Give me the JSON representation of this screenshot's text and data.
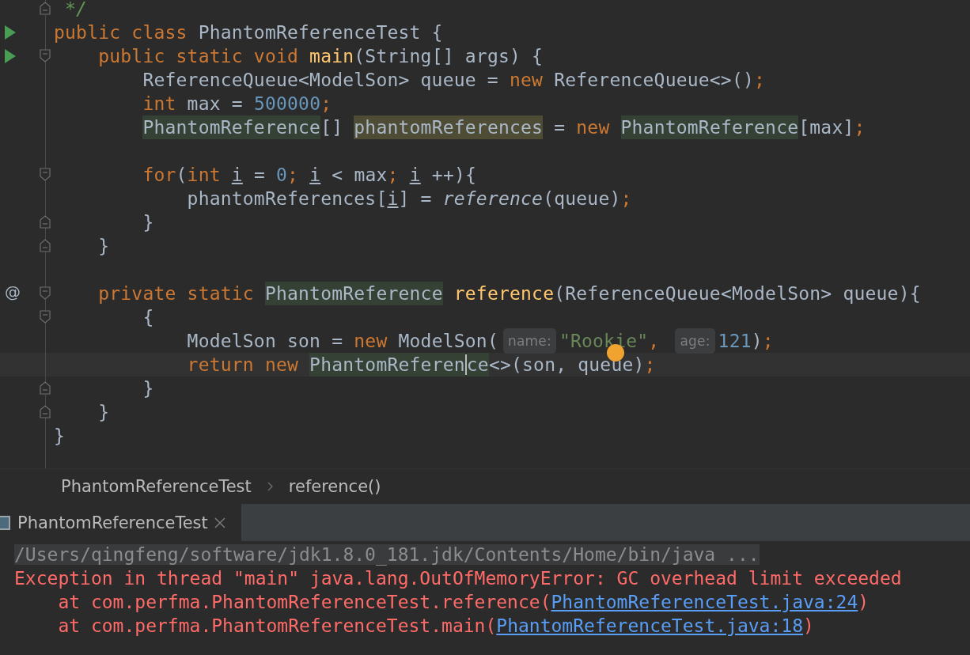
{
  "editor": {
    "lines": [
      {
        "fold_end": true,
        "tokens": [
          {
            "text": " */",
            "kind": "comment"
          }
        ]
      },
      {
        "runnable": true,
        "tokens": [
          {
            "text": "public class ",
            "kind": "keyword"
          },
          {
            "text": "PhantomReferenceTest {",
            "kind": "plain"
          }
        ]
      },
      {
        "runnable": true,
        "fold_start": true,
        "tokens": [
          {
            "text": "    public static void ",
            "kind": "keyword"
          },
          {
            "text": "main",
            "kind": "method"
          },
          {
            "text": "(String[] args) {",
            "kind": "plain"
          }
        ]
      },
      {
        "tokens": [
          {
            "text": "        ReferenceQueue<ModelSon> queue = ",
            "kind": "plain"
          },
          {
            "text": "new ",
            "kind": "keyword"
          },
          {
            "text": "ReferenceQueue<>()",
            "kind": "plain"
          },
          {
            "text": ";",
            "kind": "keyword"
          }
        ]
      },
      {
        "tokens": [
          {
            "text": "        int ",
            "kind": "keyword"
          },
          {
            "text": "max = ",
            "kind": "plain"
          },
          {
            "text": "500000",
            "kind": "number"
          },
          {
            "text": ";",
            "kind": "keyword"
          }
        ]
      },
      {
        "tokens": [
          {
            "text": "        PhantomReference",
            "kind": "class-highlight"
          },
          {
            "text": "[] ",
            "kind": "plain"
          },
          {
            "text": "phantomReferences",
            "kind": "var-highlight"
          },
          {
            "text": " = ",
            "kind": "plain"
          },
          {
            "text": "new ",
            "kind": "keyword"
          },
          {
            "text": "PhantomReference",
            "kind": "class-highlight"
          },
          {
            "text": "[max]",
            "kind": "plain"
          },
          {
            "text": ";",
            "kind": "keyword"
          }
        ]
      },
      {
        "kind": "blank"
      },
      {
        "fold_start": true,
        "tokens": [
          {
            "text": "        for",
            "kind": "keyword"
          },
          {
            "text": "(",
            "kind": "plain"
          },
          {
            "text": "int ",
            "kind": "keyword"
          },
          {
            "text": "i",
            "kind": "local"
          },
          {
            "text": " = ",
            "kind": "plain"
          },
          {
            "text": "0",
            "kind": "number"
          },
          {
            "text": "; ",
            "kind": "keyword"
          },
          {
            "text": "i",
            "kind": "local"
          },
          {
            "text": " < max",
            "kind": "plain"
          },
          {
            "text": "; ",
            "kind": "keyword"
          },
          {
            "text": "i",
            "kind": "local"
          },
          {
            "text": " ++){",
            "kind": "plain"
          }
        ]
      },
      {
        "tokens": [
          {
            "text": "            phantomReferences[",
            "kind": "plain"
          },
          {
            "text": "i",
            "kind": "local"
          },
          {
            "text": "] = ",
            "kind": "plain"
          },
          {
            "text": "reference",
            "kind": "static-call"
          },
          {
            "text": "(queue)",
            "kind": "plain"
          },
          {
            "text": ";",
            "kind": "keyword"
          }
        ]
      },
      {
        "fold_end": true,
        "tokens": [
          {
            "text": "        }",
            "kind": "plain"
          }
        ]
      },
      {
        "fold_end": true,
        "tokens": [
          {
            "text": "    }",
            "kind": "plain"
          }
        ]
      },
      {
        "kind": "blank"
      },
      {
        "gutter_text": "@",
        "fold_start": true,
        "tokens": [
          {
            "text": "    private static ",
            "kind": "keyword"
          },
          {
            "text": "PhantomReference",
            "kind": "class-highlight"
          },
          {
            "text": " reference",
            "kind": "method"
          },
          {
            "text": "(ReferenceQueue<ModelSon> queue){",
            "kind": "plain"
          }
        ]
      },
      {
        "fold_start": true,
        "tokens": [
          {
            "text": "        {",
            "kind": "plain"
          }
        ]
      },
      {
        "tokens": [
          {
            "text": "            ModelSon son = ",
            "kind": "plain"
          },
          {
            "text": "new ",
            "kind": "keyword"
          },
          {
            "text": "ModelSon(",
            "kind": "plain"
          },
          {
            "text": "name:",
            "kind": "hint"
          },
          {
            "text": "\"Rookie\"",
            "kind": "string"
          },
          {
            "text": ", ",
            "kind": "keyword"
          },
          {
            "text": "age:",
            "kind": "hint"
          },
          {
            "text": "121",
            "kind": "number"
          },
          {
            "text": ")",
            "kind": "plain"
          },
          {
            "text": ";",
            "kind": "keyword"
          }
        ]
      },
      {
        "current": true,
        "tokens": [
          {
            "text": "            return new ",
            "kind": "keyword"
          },
          {
            "text": "PhantomReferen",
            "kind": "class-highlight",
            "caret_after": true
          },
          {
            "text": "ce",
            "kind": "class-highlight"
          },
          {
            "text": "<>(son, queue)",
            "kind": "plain"
          },
          {
            "text": ";",
            "kind": "keyword"
          }
        ]
      },
      {
        "fold_end": true,
        "tokens": [
          {
            "text": "        }",
            "kind": "plain"
          }
        ]
      },
      {
        "fold_end": true,
        "tokens": [
          {
            "text": "    }",
            "kind": "plain"
          }
        ]
      },
      {
        "tokens": [
          {
            "text": "}",
            "kind": "plain"
          }
        ]
      }
    ]
  },
  "breadcrumbs": [
    "PhantomReferenceTest",
    "reference()"
  ],
  "run_panel": {
    "tabs": [
      {
        "label": "PhantomReferenceTest",
        "selected": true
      }
    ],
    "console": [
      {
        "kind": "command",
        "parts": [
          {
            "text": "/Users/qingfeng/software/jdk1.8.0_181.jdk/Contents/Home/bin/java ..."
          }
        ]
      },
      {
        "kind": "error",
        "parts": [
          {
            "text": "Exception in thread \"main\" java.lang.OutOfMemoryError: GC overhead limit exceeded"
          }
        ]
      },
      {
        "kind": "error",
        "parts": [
          {
            "text": "    at com.perfma.PhantomReferenceTest.reference("
          },
          {
            "text": "PhantomReferenceTest.java:24",
            "link": true
          },
          {
            "text": ")"
          }
        ]
      },
      {
        "kind": "error",
        "parts": [
          {
            "text": "    at com.perfma.PhantomReferenceTest.main("
          },
          {
            "text": "PhantomReferenceTest.java:18",
            "link": true
          },
          {
            "text": ")"
          }
        ]
      }
    ]
  }
}
